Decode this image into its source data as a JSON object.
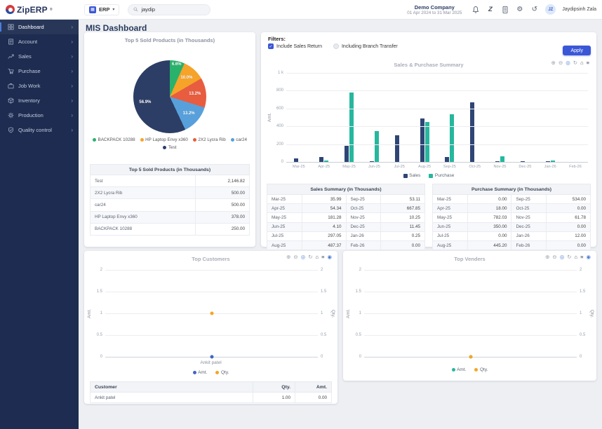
{
  "topbar": {
    "logo_text": "ZipERP",
    "logo_reg": "®",
    "erp_menu_label": "ERP",
    "search_value": "jaydip",
    "company_name": "Demo Company",
    "date_range": "01 Apr 2024 to 31 Mar 2025",
    "action_icons": [
      "notification-bell",
      "chat",
      "calculator",
      "settings-gear",
      "history"
    ],
    "user_initials": "JZ",
    "user_name": "Jaydipsinh Zala"
  },
  "sidebar": {
    "items": [
      {
        "label": "Dashboard",
        "icon": "dashboard-icon",
        "active": true
      },
      {
        "label": "Account",
        "icon": "account-icon",
        "active": false
      },
      {
        "label": "Sales",
        "icon": "sales-icon",
        "active": false
      },
      {
        "label": "Purchase",
        "icon": "purchase-icon",
        "active": false
      },
      {
        "label": "Job Work",
        "icon": "jobwork-icon",
        "active": false
      },
      {
        "label": "Inventory",
        "icon": "inventory-icon",
        "active": false
      },
      {
        "label": "Production",
        "icon": "production-icon",
        "active": false
      },
      {
        "label": "Quality control",
        "icon": "quality-icon",
        "active": false
      }
    ]
  },
  "page": {
    "title": "MIS Dashboard"
  },
  "filters": {
    "label": "Filters:",
    "checkboxes": [
      {
        "label": "Include Sales Return",
        "checked": true
      },
      {
        "label": "Including Branch Transfer",
        "checked": false
      }
    ],
    "apply_label": "Apply"
  },
  "chart_data": [
    {
      "id": "top-5-sold-products",
      "type": "pie",
      "title": "Top 5 Sold Products (in Thousands)",
      "slices": [
        {
          "label": "BACKPACK 10288",
          "value": 250.0,
          "pct": 6.6,
          "pct_label": "6.6%",
          "color": "#29b26b"
        },
        {
          "label": "HP Laptop Envy x360",
          "value": 378.0,
          "pct": 10.0,
          "pct_label": "10.0%",
          "color": "#f6a32a"
        },
        {
          "label": "2X2 Lycra Rib",
          "value": 500.0,
          "pct": 13.2,
          "pct_label": "13.2%",
          "color": "#e85c3f"
        },
        {
          "label": "car24",
          "value": 500.0,
          "pct": 13.2,
          "pct_label": "13.2%",
          "color": "#57a0dc"
        },
        {
          "label": "Test",
          "value": 2146.82,
          "pct": 56.9,
          "pct_label": "56.9%",
          "color": "#2c3e66"
        }
      ],
      "legend_position": "bottom"
    },
    {
      "id": "sales-purchase-summary",
      "type": "bar",
      "title": "Sales & Purchase Summary",
      "ylabel": "Amt.",
      "ylim": [
        0,
        1000
      ],
      "yticks_top_down": [
        "1 k",
        "800",
        "600",
        "400",
        "200",
        "0"
      ],
      "categories": [
        "Mar-25",
        "Apr-25",
        "May-25",
        "Jun-25",
        "Jul-25",
        "Aug-25",
        "Sep-25",
        "Oct-25",
        "Nov-25",
        "Dec-25",
        "Jan-26",
        "Feb-26"
      ],
      "series": [
        {
          "name": "Sales",
          "color": "#2f4575",
          "values": [
            35.99,
            54.34,
            181.28,
            4.1,
            297.05,
            487.37,
            53.11,
            667.85,
            10.25,
            11.45,
            0.25,
            0.0
          ]
        },
        {
          "name": "Purchase",
          "color": "#26b79e",
          "values": [
            0.0,
            18.0,
            782.03,
            350.0,
            0.0,
            445.2,
            534.0,
            0.0,
            61.78,
            0.0,
            12.0,
            0.0
          ]
        }
      ],
      "grid": true,
      "legend_position": "bottom",
      "toolbar": [
        "zoom-in",
        "zoom-out",
        "zoom-window",
        "restore",
        "home",
        "data-view"
      ]
    },
    {
      "id": "top-customers",
      "type": "scatter",
      "title": "Top Customers",
      "categories": [
        "Ankit patel"
      ],
      "left_axis": {
        "label": "Amt.",
        "ticks_top_down": [
          "2",
          "1.5",
          "1",
          "0.5",
          "0"
        ],
        "max": 2
      },
      "right_axis": {
        "label": "Qty.",
        "ticks_top_down": [
          "2",
          "1.5",
          "1",
          "0.5",
          "0"
        ],
        "max": 2
      },
      "series": [
        {
          "name": "Amt.",
          "color": "#4365c2",
          "values": [
            0.0
          ]
        },
        {
          "name": "Qty.",
          "color": "#f5a623",
          "values": [
            1.0
          ]
        }
      ],
      "legend_position": "bottom",
      "toolbar": [
        "zoom-in",
        "zoom-out",
        "zoom-window",
        "restore",
        "home",
        "data-view",
        "search"
      ]
    },
    {
      "id": "top-venders",
      "type": "scatter",
      "title": "Top Venders",
      "categories": [
        ""
      ],
      "left_axis": {
        "label": "Amt.",
        "ticks_top_down": [
          "2",
          "1.5",
          "1",
          "0.5",
          "0"
        ],
        "max": 2
      },
      "right_axis": {
        "label": "Qty.",
        "ticks_top_down": [
          "2",
          "1.5",
          "1",
          "0.5",
          "0"
        ],
        "max": 2
      },
      "series": [
        {
          "name": "Amt.",
          "color": "#26b79e",
          "values": [
            0.0
          ]
        },
        {
          "name": "Qty.",
          "color": "#f5a623",
          "values": [
            0.0
          ]
        }
      ],
      "legend_position": "bottom",
      "toolbar": [
        "zoom-in",
        "zoom-out",
        "zoom-window",
        "restore",
        "home",
        "data-view",
        "search"
      ]
    }
  ],
  "tables": {
    "top_products": {
      "header": "Top 5 Sold Products (in Thousands)",
      "rows": [
        [
          "Test",
          "2,146.82"
        ],
        [
          "2X2 Lycra Rib",
          "500.00"
        ],
        [
          "car24",
          "500.00"
        ],
        [
          "HP Laptop Envy x360",
          "378.00"
        ],
        [
          "BACKPACK 10288",
          "250.00"
        ]
      ]
    },
    "sales_summary": {
      "header": "Sales Summary (in Thousands)",
      "rows": [
        [
          "Mar-25",
          "35.99",
          "Sep-25",
          "53.11"
        ],
        [
          "Apr-25",
          "54.34",
          "Oct-25",
          "667.85"
        ],
        [
          "May-25",
          "181.28",
          "Nov-25",
          "10.25"
        ],
        [
          "Jun-25",
          "4.10",
          "Dec-25",
          "11.45"
        ],
        [
          "Jul-25",
          "297.05",
          "Jan-26",
          "0.25"
        ],
        [
          "Aug-25",
          "487.37",
          "Feb-26",
          "0.00"
        ]
      ]
    },
    "purchase_summary": {
      "header": "Purchase Summary (in Thousands)",
      "rows": [
        [
          "Mar-25",
          "0.00",
          "Sep-25",
          "534.00"
        ],
        [
          "Apr-25",
          "18.00",
          "Oct-25",
          "0.00"
        ],
        [
          "May-25",
          "782.03",
          "Nov-25",
          "61.78"
        ],
        [
          "Jun-25",
          "350.00",
          "Dec-25",
          "0.00"
        ],
        [
          "Jul-25",
          "0.00",
          "Jan-26",
          "12.00"
        ],
        [
          "Aug-25",
          "445.20",
          "Feb-26",
          "0.00"
        ]
      ]
    },
    "customers": {
      "columns": [
        "Customer",
        "Qty.",
        "Amt."
      ],
      "rows": [
        [
          "Ankit patel",
          "1.00",
          "0.00"
        ]
      ]
    }
  }
}
